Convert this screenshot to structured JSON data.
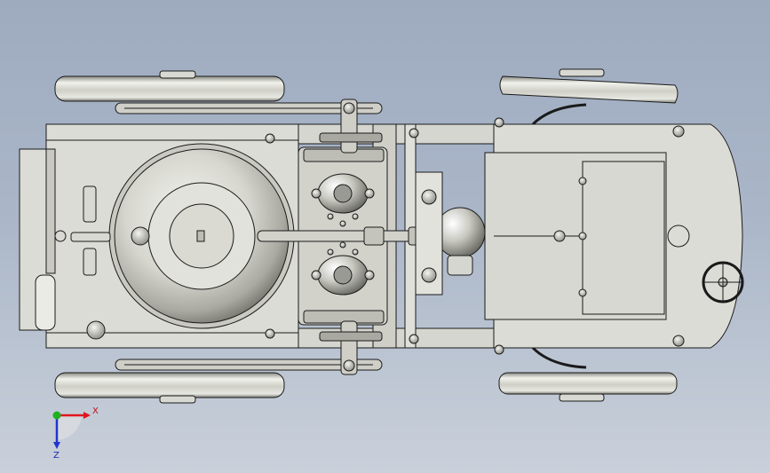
{
  "triad": {
    "x_label": "X",
    "z_label": "Z",
    "x_color": "#e0161e",
    "y_color": "#20b020",
    "z_color": "#2233cc"
  },
  "colors": {
    "background_top": "#9eabbf",
    "background_bottom": "#c9d0da",
    "part_fill": "#d9d9d3",
    "part_shade": "#a9a9a2",
    "edge": "#1a1a1a"
  }
}
